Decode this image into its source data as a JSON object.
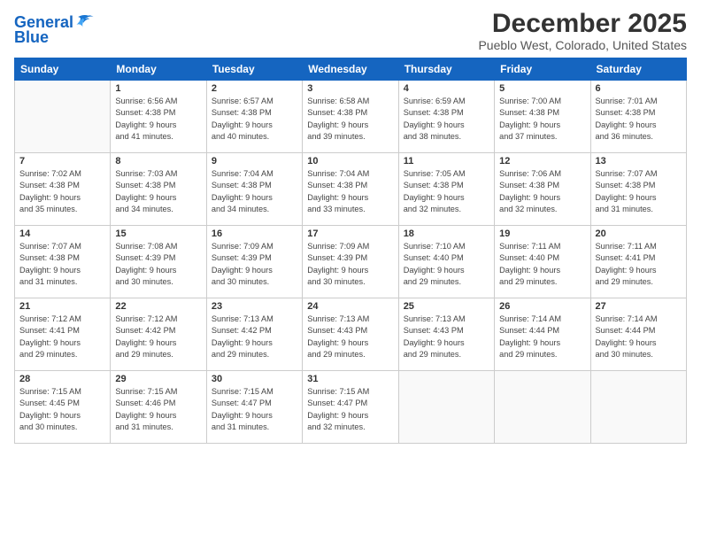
{
  "logo": {
    "line1": "General",
    "line2": "Blue"
  },
  "title": "December 2025",
  "location": "Pueblo West, Colorado, United States",
  "days_of_week": [
    "Sunday",
    "Monday",
    "Tuesday",
    "Wednesday",
    "Thursday",
    "Friday",
    "Saturday"
  ],
  "weeks": [
    [
      {
        "day": "",
        "info": ""
      },
      {
        "day": "1",
        "info": "Sunrise: 6:56 AM\nSunset: 4:38 PM\nDaylight: 9 hours\nand 41 minutes."
      },
      {
        "day": "2",
        "info": "Sunrise: 6:57 AM\nSunset: 4:38 PM\nDaylight: 9 hours\nand 40 minutes."
      },
      {
        "day": "3",
        "info": "Sunrise: 6:58 AM\nSunset: 4:38 PM\nDaylight: 9 hours\nand 39 minutes."
      },
      {
        "day": "4",
        "info": "Sunrise: 6:59 AM\nSunset: 4:38 PM\nDaylight: 9 hours\nand 38 minutes."
      },
      {
        "day": "5",
        "info": "Sunrise: 7:00 AM\nSunset: 4:38 PM\nDaylight: 9 hours\nand 37 minutes."
      },
      {
        "day": "6",
        "info": "Sunrise: 7:01 AM\nSunset: 4:38 PM\nDaylight: 9 hours\nand 36 minutes."
      }
    ],
    [
      {
        "day": "7",
        "info": "Sunrise: 7:02 AM\nSunset: 4:38 PM\nDaylight: 9 hours\nand 35 minutes."
      },
      {
        "day": "8",
        "info": "Sunrise: 7:03 AM\nSunset: 4:38 PM\nDaylight: 9 hours\nand 34 minutes."
      },
      {
        "day": "9",
        "info": "Sunrise: 7:04 AM\nSunset: 4:38 PM\nDaylight: 9 hours\nand 34 minutes."
      },
      {
        "day": "10",
        "info": "Sunrise: 7:04 AM\nSunset: 4:38 PM\nDaylight: 9 hours\nand 33 minutes."
      },
      {
        "day": "11",
        "info": "Sunrise: 7:05 AM\nSunset: 4:38 PM\nDaylight: 9 hours\nand 32 minutes."
      },
      {
        "day": "12",
        "info": "Sunrise: 7:06 AM\nSunset: 4:38 PM\nDaylight: 9 hours\nand 32 minutes."
      },
      {
        "day": "13",
        "info": "Sunrise: 7:07 AM\nSunset: 4:38 PM\nDaylight: 9 hours\nand 31 minutes."
      }
    ],
    [
      {
        "day": "14",
        "info": "Sunrise: 7:07 AM\nSunset: 4:38 PM\nDaylight: 9 hours\nand 31 minutes."
      },
      {
        "day": "15",
        "info": "Sunrise: 7:08 AM\nSunset: 4:39 PM\nDaylight: 9 hours\nand 30 minutes."
      },
      {
        "day": "16",
        "info": "Sunrise: 7:09 AM\nSunset: 4:39 PM\nDaylight: 9 hours\nand 30 minutes."
      },
      {
        "day": "17",
        "info": "Sunrise: 7:09 AM\nSunset: 4:39 PM\nDaylight: 9 hours\nand 30 minutes."
      },
      {
        "day": "18",
        "info": "Sunrise: 7:10 AM\nSunset: 4:40 PM\nDaylight: 9 hours\nand 29 minutes."
      },
      {
        "day": "19",
        "info": "Sunrise: 7:11 AM\nSunset: 4:40 PM\nDaylight: 9 hours\nand 29 minutes."
      },
      {
        "day": "20",
        "info": "Sunrise: 7:11 AM\nSunset: 4:41 PM\nDaylight: 9 hours\nand 29 minutes."
      }
    ],
    [
      {
        "day": "21",
        "info": "Sunrise: 7:12 AM\nSunset: 4:41 PM\nDaylight: 9 hours\nand 29 minutes."
      },
      {
        "day": "22",
        "info": "Sunrise: 7:12 AM\nSunset: 4:42 PM\nDaylight: 9 hours\nand 29 minutes."
      },
      {
        "day": "23",
        "info": "Sunrise: 7:13 AM\nSunset: 4:42 PM\nDaylight: 9 hours\nand 29 minutes."
      },
      {
        "day": "24",
        "info": "Sunrise: 7:13 AM\nSunset: 4:43 PM\nDaylight: 9 hours\nand 29 minutes."
      },
      {
        "day": "25",
        "info": "Sunrise: 7:13 AM\nSunset: 4:43 PM\nDaylight: 9 hours\nand 29 minutes."
      },
      {
        "day": "26",
        "info": "Sunrise: 7:14 AM\nSunset: 4:44 PM\nDaylight: 9 hours\nand 29 minutes."
      },
      {
        "day": "27",
        "info": "Sunrise: 7:14 AM\nSunset: 4:44 PM\nDaylight: 9 hours\nand 30 minutes."
      }
    ],
    [
      {
        "day": "28",
        "info": "Sunrise: 7:15 AM\nSunset: 4:45 PM\nDaylight: 9 hours\nand 30 minutes."
      },
      {
        "day": "29",
        "info": "Sunrise: 7:15 AM\nSunset: 4:46 PM\nDaylight: 9 hours\nand 31 minutes."
      },
      {
        "day": "30",
        "info": "Sunrise: 7:15 AM\nSunset: 4:47 PM\nDaylight: 9 hours\nand 31 minutes."
      },
      {
        "day": "31",
        "info": "Sunrise: 7:15 AM\nSunset: 4:47 PM\nDaylight: 9 hours\nand 32 minutes."
      },
      {
        "day": "",
        "info": ""
      },
      {
        "day": "",
        "info": ""
      },
      {
        "day": "",
        "info": ""
      }
    ]
  ]
}
